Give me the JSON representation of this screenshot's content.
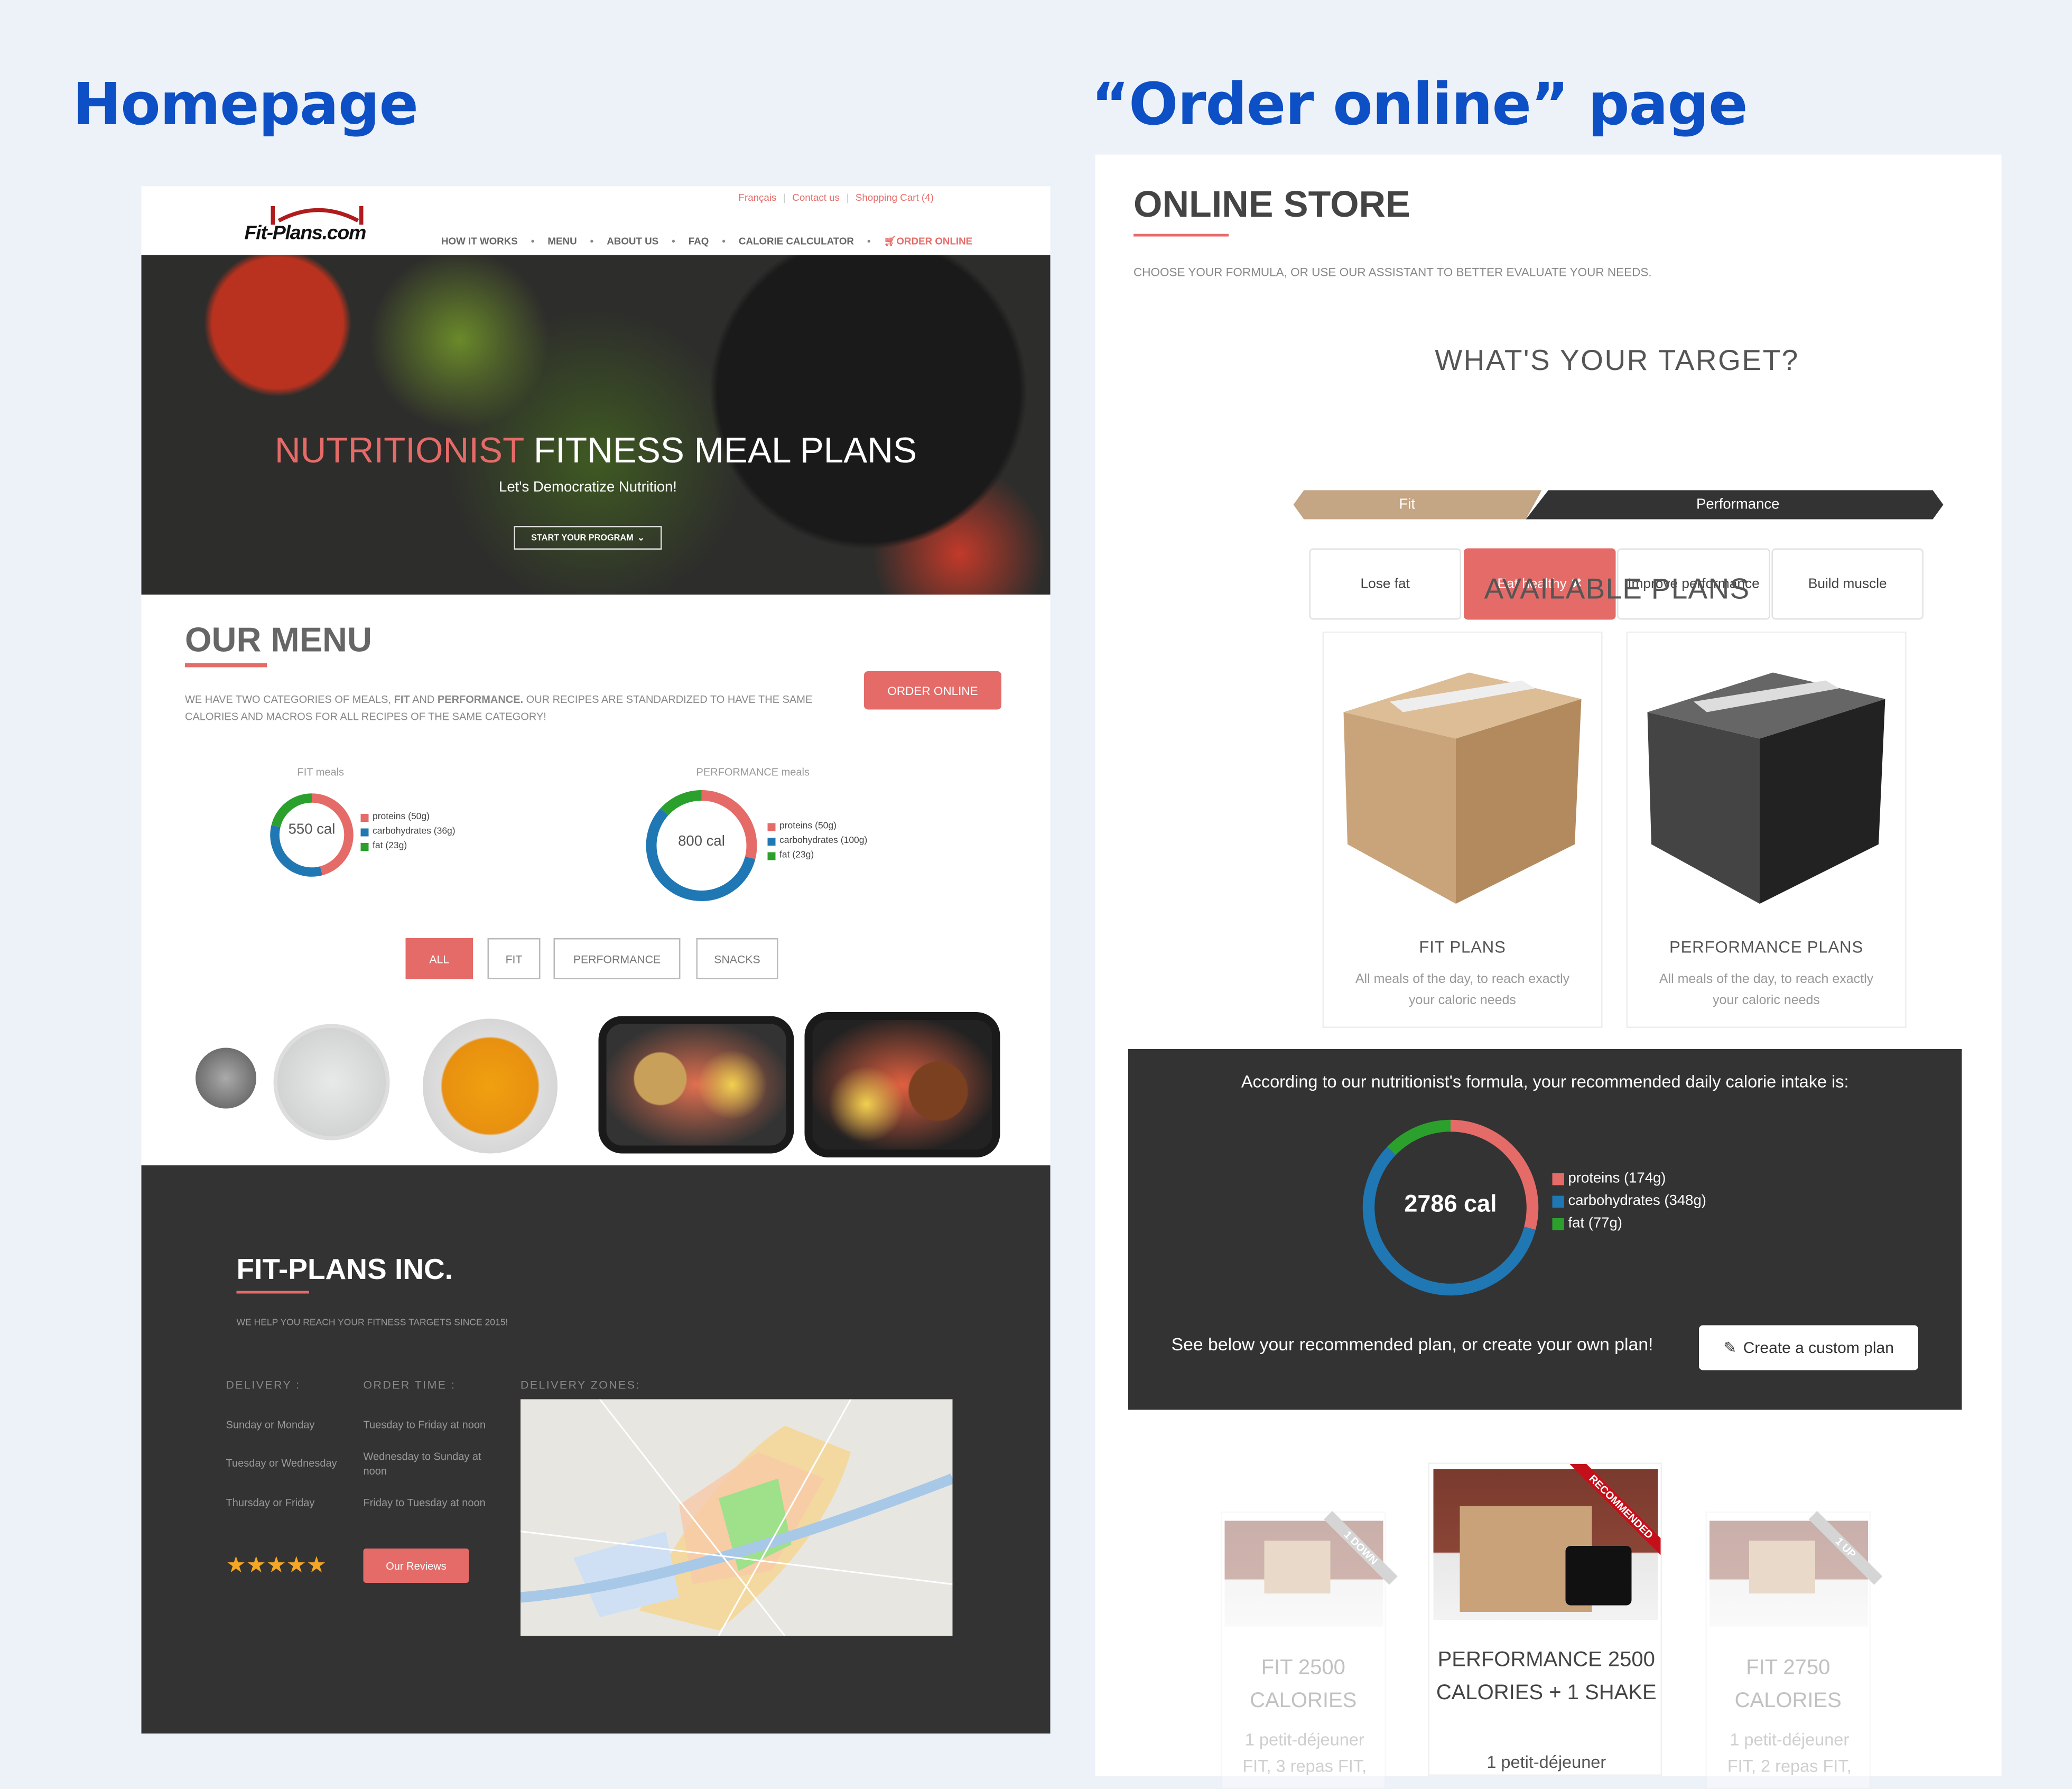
{
  "titles": {
    "homepage": "Homepage",
    "order_page": "“Order online” page"
  },
  "colors": {
    "accent": "#e56b68",
    "title_blue": "#0d4fc4",
    "dark": "#333333",
    "proteins": "#e56b68",
    "carbohydrates": "#1f77b4",
    "fat": "#2ca02c",
    "fit": "#c4a584"
  },
  "home": {
    "top_links": [
      "Français",
      "Contact us",
      "Shopping Cart (4)"
    ],
    "logo": "Fit-Plans.com",
    "nav": [
      "HOW IT WORKS",
      "MENU",
      "ABOUT US",
      "FAQ",
      "CALORIE CALCULATOR"
    ],
    "nav_order": "ORDER ONLINE",
    "hero": {
      "title_accent": "NUTRITIONIST",
      "title_rest": "FITNESS MEAL PLANS",
      "subtitle": "Let's Democratize Nutrition!",
      "cta": "START YOUR PROGRAM"
    },
    "menu": {
      "title": "OUR MENU",
      "desc_1": "WE HAVE TWO CATEGORIES OF MEALS, ",
      "desc_fit": "FIT",
      "desc_and": " AND ",
      "desc_perf": "PERFORMANCE.",
      "desc_2": " OUR RECIPES ARE STANDARDIZED TO HAVE THE SAME CALORIES AND MACROS FOR ALL RECIPES OF THE SAME CATEGORY!",
      "order_btn": "ORDER ONLINE",
      "filters": [
        "ALL",
        "FIT",
        "PERFORMANCE",
        "SNACKS"
      ],
      "active_filter": "ALL"
    },
    "footer": {
      "title": "FIT-PLANS INC.",
      "tagline": "WE HELP YOU REACH YOUR FITNESS TARGETS SINCE 2015!",
      "delivery_h": "DELIVERY :",
      "order_h": "ORDER TIME :",
      "zones_h": "DELIVERY ZONES:",
      "rows": [
        {
          "delivery": "Sunday or Monday",
          "order": "Tuesday to Friday at noon"
        },
        {
          "delivery": "Tuesday or Wednesday",
          "order": "Wednesday to Sunday at noon"
        },
        {
          "delivery": "Thursday or Friday",
          "order": "Friday to Tuesday at noon"
        }
      ],
      "rating_stars": 5,
      "stars": "★★★★★",
      "reviews_btn": "Our Reviews"
    }
  },
  "chart_data": [
    {
      "type": "pie",
      "title": "FIT meals",
      "center_label": "550 cal",
      "categories": [
        "proteins (50g)",
        "carbohydrates (36g)",
        "fat (23g)"
      ],
      "values": [
        50,
        36,
        23
      ],
      "unit": "g"
    },
    {
      "type": "pie",
      "title": "PERFORMANCE meals",
      "center_label": "800 cal",
      "categories": [
        "proteins (50g)",
        "carbohydrates (100g)",
        "fat (23g)"
      ],
      "values": [
        50,
        100,
        23
      ],
      "unit": "g"
    },
    {
      "type": "pie",
      "title": "",
      "center_label": "2786 cal",
      "categories": [
        "proteins (174g)",
        "carbohydrates (348g)",
        "fat (77g)"
      ],
      "values": [
        174,
        348,
        77
      ],
      "unit": "g"
    }
  ],
  "store": {
    "title": "ONLINE STORE",
    "subtitle": "CHOOSE YOUR FORMULA, OR USE OUR ASSISTANT TO BETTER EVALUATE YOUR NEEDS.",
    "target_title": "WHAT'S YOUR TARGET?",
    "targets": [
      "Lose fat",
      "Eat healthy",
      "Improve performance",
      "Build muscle"
    ],
    "selected_target": "Eat healthy",
    "close_glyph": "✖",
    "scale": [
      "Fit",
      "Performance"
    ],
    "plans_title": "AVAILABLE PLANS",
    "plans": [
      {
        "title": "FIT PLANS",
        "desc": "All meals of the day, to reach exactly your caloric needs"
      },
      {
        "title": "PERFORMANCE PLANS",
        "desc": "All meals of the day, to reach exactly your caloric needs"
      }
    ],
    "recommend": {
      "intro": "According to our nutritionist's formula, your recommended daily calorie intake is:",
      "below": "See below your recommended plan, or create your own plan!",
      "custom_btn": "Create a custom plan"
    },
    "products": [
      {
        "ribbon": "1 DOWN",
        "title": "FIT 2500 CALORIES",
        "desc": "1 petit-déjeuner FIT, 3 repas FIT,"
      },
      {
        "ribbon": "RECOMMENDED",
        "title": "PERFORMANCE 2500 CALORIES + 1 SHAKE",
        "desc": "1 petit-déjeuner"
      },
      {
        "ribbon": "1 UP",
        "title": "FIT 2750 CALORIES",
        "desc": "1 petit-déjeuner FIT, 2 repas FIT,"
      }
    ]
  }
}
